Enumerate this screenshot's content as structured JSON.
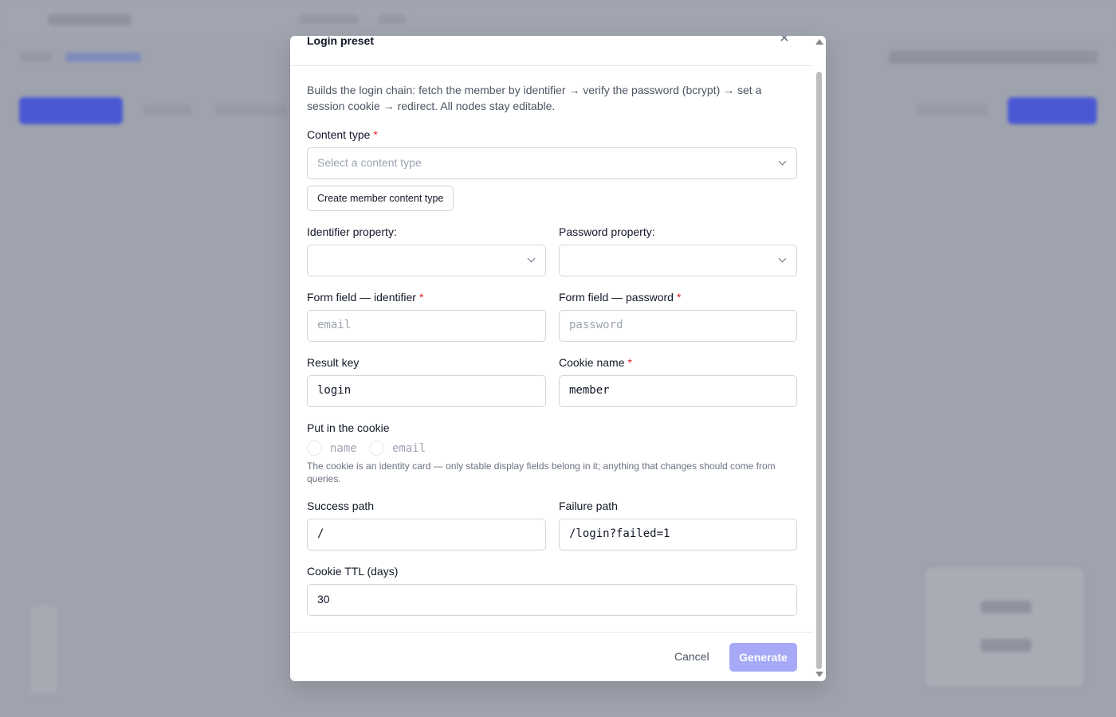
{
  "modal": {
    "title": "Login preset",
    "description": "Builds the login chain: fetch the member by identifier → verify the password (bcrypt) → set a session cookie → redirect. All nodes stay editable.",
    "content_type": {
      "label": "Content type",
      "required": "*",
      "placeholder": "Select a content type",
      "create_button": "Create member content type"
    },
    "identifier_property": {
      "label": "Identifier property:",
      "value": ""
    },
    "password_property": {
      "label": "Password property:",
      "value": ""
    },
    "form_field_identifier": {
      "label": "Form field — identifier",
      "required": "*",
      "placeholder": "email",
      "value": ""
    },
    "form_field_password": {
      "label": "Form field — password",
      "required": "*",
      "placeholder": "password",
      "value": ""
    },
    "result_key": {
      "label": "Result key",
      "value": "login"
    },
    "cookie_name": {
      "label": "Cookie name",
      "required": "*",
      "value": "member"
    },
    "cookie_contents": {
      "label": "Put in the cookie",
      "options": [
        {
          "label": "name",
          "checked": false
        },
        {
          "label": "email",
          "checked": false
        }
      ],
      "hint": "The cookie is an identity card — only stable display fields belong in it; anything that changes should come from queries."
    },
    "success_path": {
      "label": "Success path",
      "value": "/"
    },
    "failure_path": {
      "label": "Failure path",
      "value": "/login?failed=1"
    },
    "cookie_ttl": {
      "label": "Cookie TTL (days)",
      "value": "30"
    },
    "footer": {
      "cancel": "Cancel",
      "generate": "Generate"
    },
    "icons": {
      "close": "close-icon",
      "select": "chevron-down-icon"
    },
    "colors": {
      "accent_disabled": "#a5a9f6",
      "required": "#dc2626"
    }
  }
}
